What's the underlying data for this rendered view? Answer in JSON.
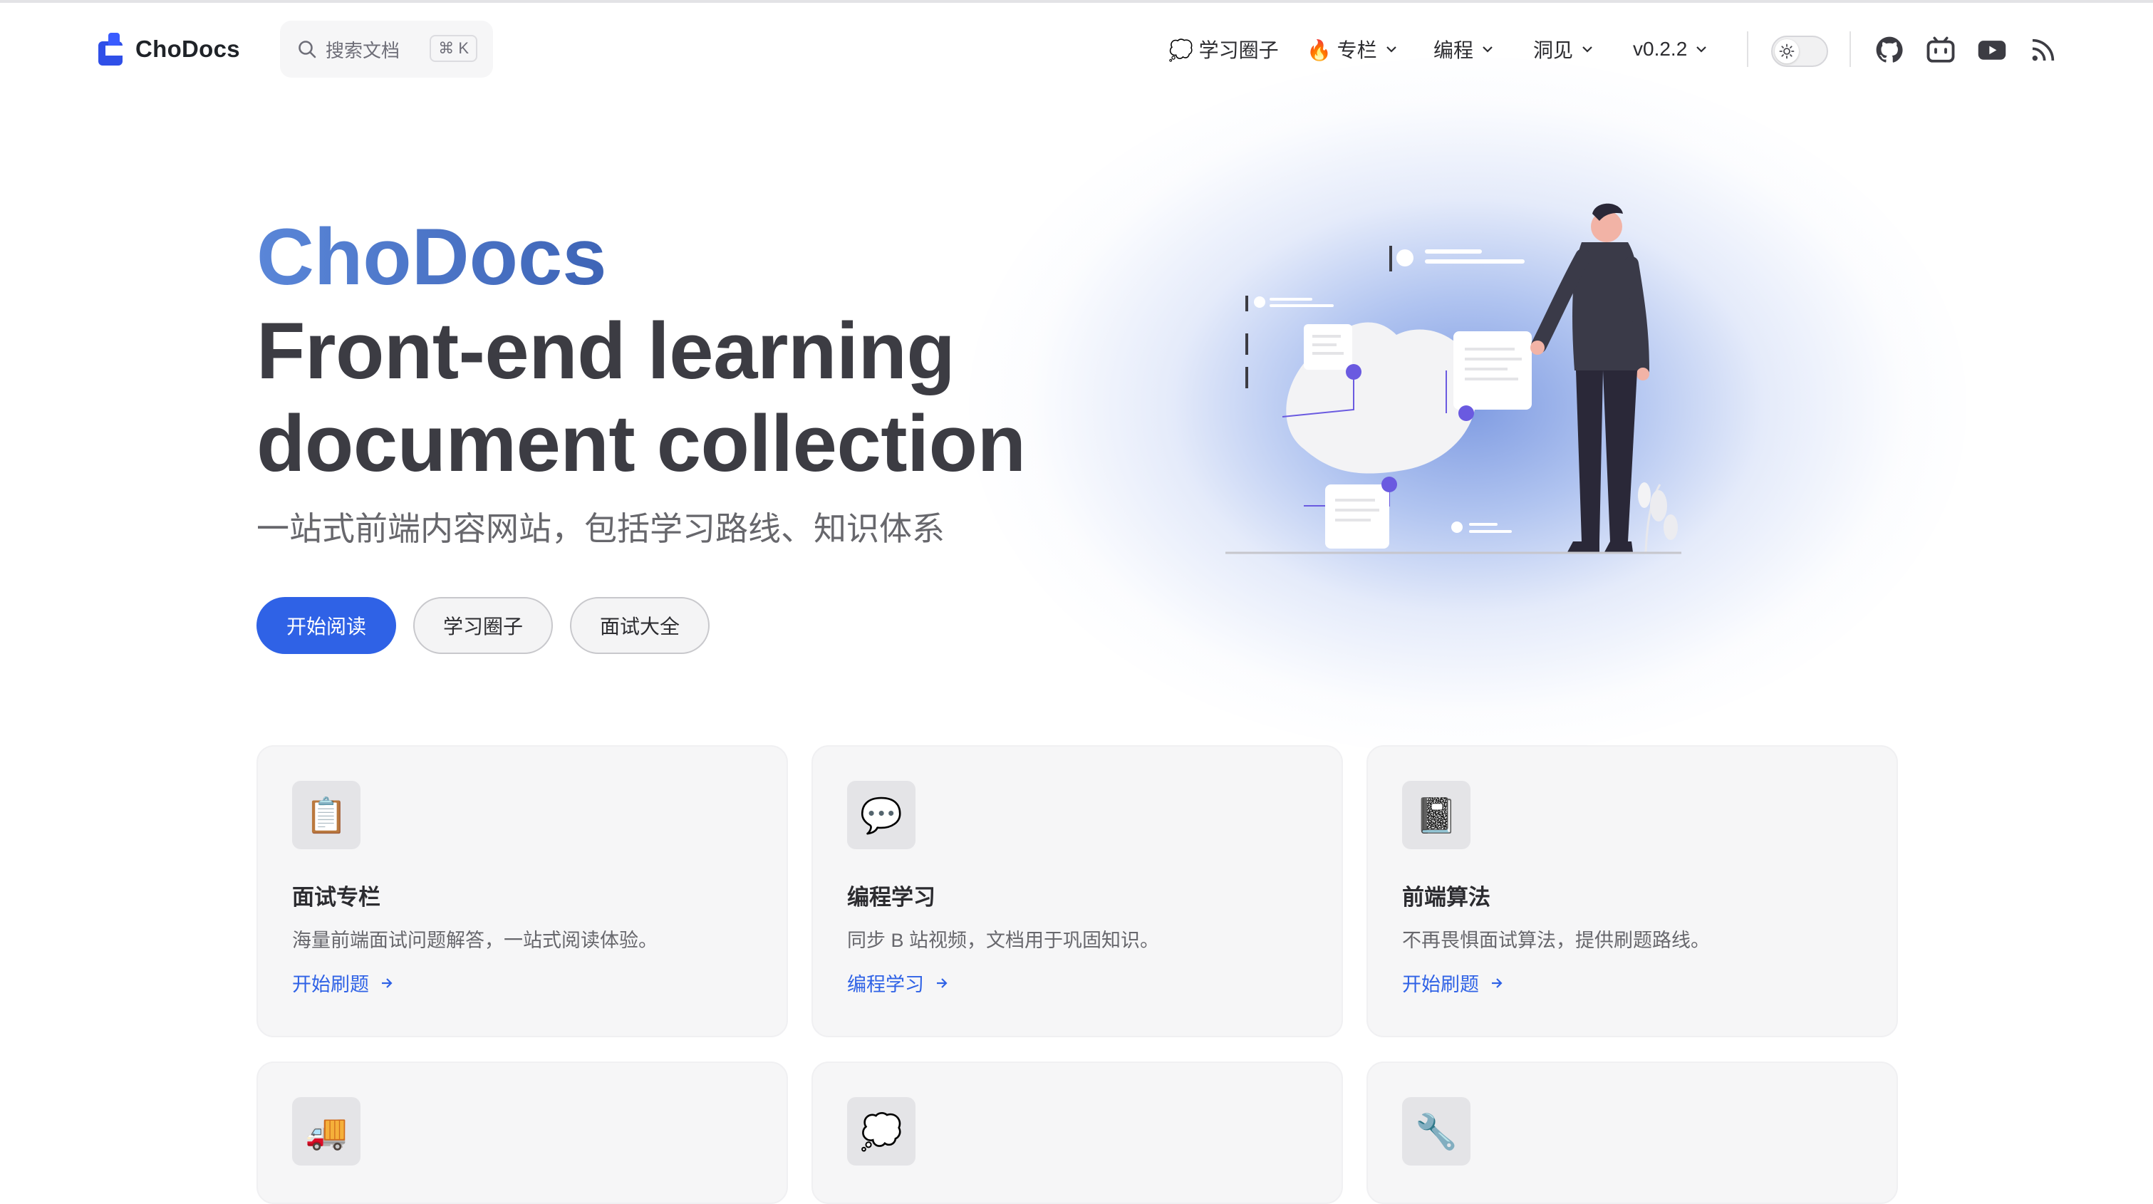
{
  "nav": {
    "logo_text": "ChoDocs",
    "search_placeholder": "搜索文档",
    "search_shortcut": "⌘ K",
    "items": [
      {
        "label": "💭 学习圈子",
        "has_dropdown": false
      },
      {
        "label": "🔥 专栏",
        "has_dropdown": true
      },
      {
        "label": "编程",
        "has_dropdown": true
      },
      {
        "label": "洞见",
        "has_dropdown": true
      },
      {
        "label": "v0.2.2",
        "has_dropdown": true
      }
    ],
    "social_icons": [
      "github-icon",
      "bilibili-icon",
      "youtube-icon",
      "rss-icon"
    ]
  },
  "hero": {
    "name": "ChoDocs",
    "text_line1": "Front-end learning",
    "text_line2": "document collection",
    "tagline": "一站式前端内容网站，包括学习路线、知识体系",
    "actions": [
      "开始阅读",
      "学习圈子",
      "面试大全"
    ]
  },
  "features": [
    {
      "icon": "📋",
      "icon_name": "clipboard-icon",
      "title": "面试专栏",
      "details": "海量前端面试问题解答，一站式阅读体验。",
      "link": "开始刷题"
    },
    {
      "icon": "💬",
      "icon_name": "speech-bubble-icon",
      "title": "编程学习",
      "details": "同步 B 站视频，文档用于巩固知识。",
      "link": "编程学习"
    },
    {
      "icon": "📓",
      "icon_name": "notebook-icon",
      "title": "前端算法",
      "details": "不再畏惧面试算法，提供刷题路线。",
      "link": "开始刷题"
    },
    {
      "icon": "🚚",
      "icon_name": "truck-icon"
    },
    {
      "icon": "💭",
      "icon_name": "thought-bubble-icon"
    },
    {
      "icon": "🔧",
      "icon_name": "wrench-icon"
    }
  ],
  "colors": {
    "brand": "#2f62e6",
    "hero_gradient_start": "#5a86d8",
    "hero_gradient_end": "#3e64b6"
  }
}
